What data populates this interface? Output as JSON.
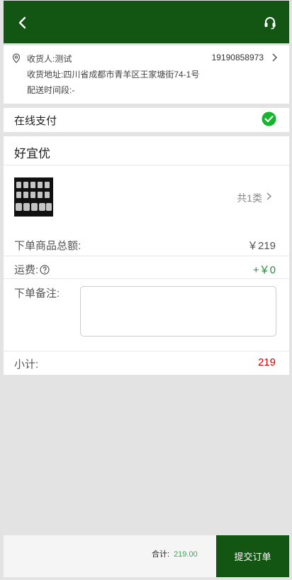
{
  "header": {
    "back_icon": "chevron-left-icon",
    "support_icon": "headset-icon",
    "background": "#135512"
  },
  "address": {
    "receiver": "收货人:测试",
    "phone": "19190858973",
    "address_line": "收货地址:四川省成都市青羊区王家塘街74-1号",
    "delivery_time": "配送时间段:-"
  },
  "payment": {
    "method": "在线支付",
    "selected": true
  },
  "order": {
    "store_name": "好宜优",
    "item_count": "共1类",
    "goods_total_label": "下单商品总额:",
    "goods_total_value": "￥219",
    "shipping_label": "运费:",
    "shipping_value": "+￥0",
    "remark_label": "下单备注:",
    "remark_placeholder": "",
    "subtotal_label": "小计:",
    "subtotal_value": "219"
  },
  "footer": {
    "total_label": "合计:",
    "total_value": "219.00",
    "submit_label": "提交订单"
  },
  "colors": {
    "brand": "#135512",
    "price_green": "#2e8b3b",
    "subtotal_red": "#d40000",
    "total_green": "#3ca65a",
    "check_green": "#19b42d"
  }
}
